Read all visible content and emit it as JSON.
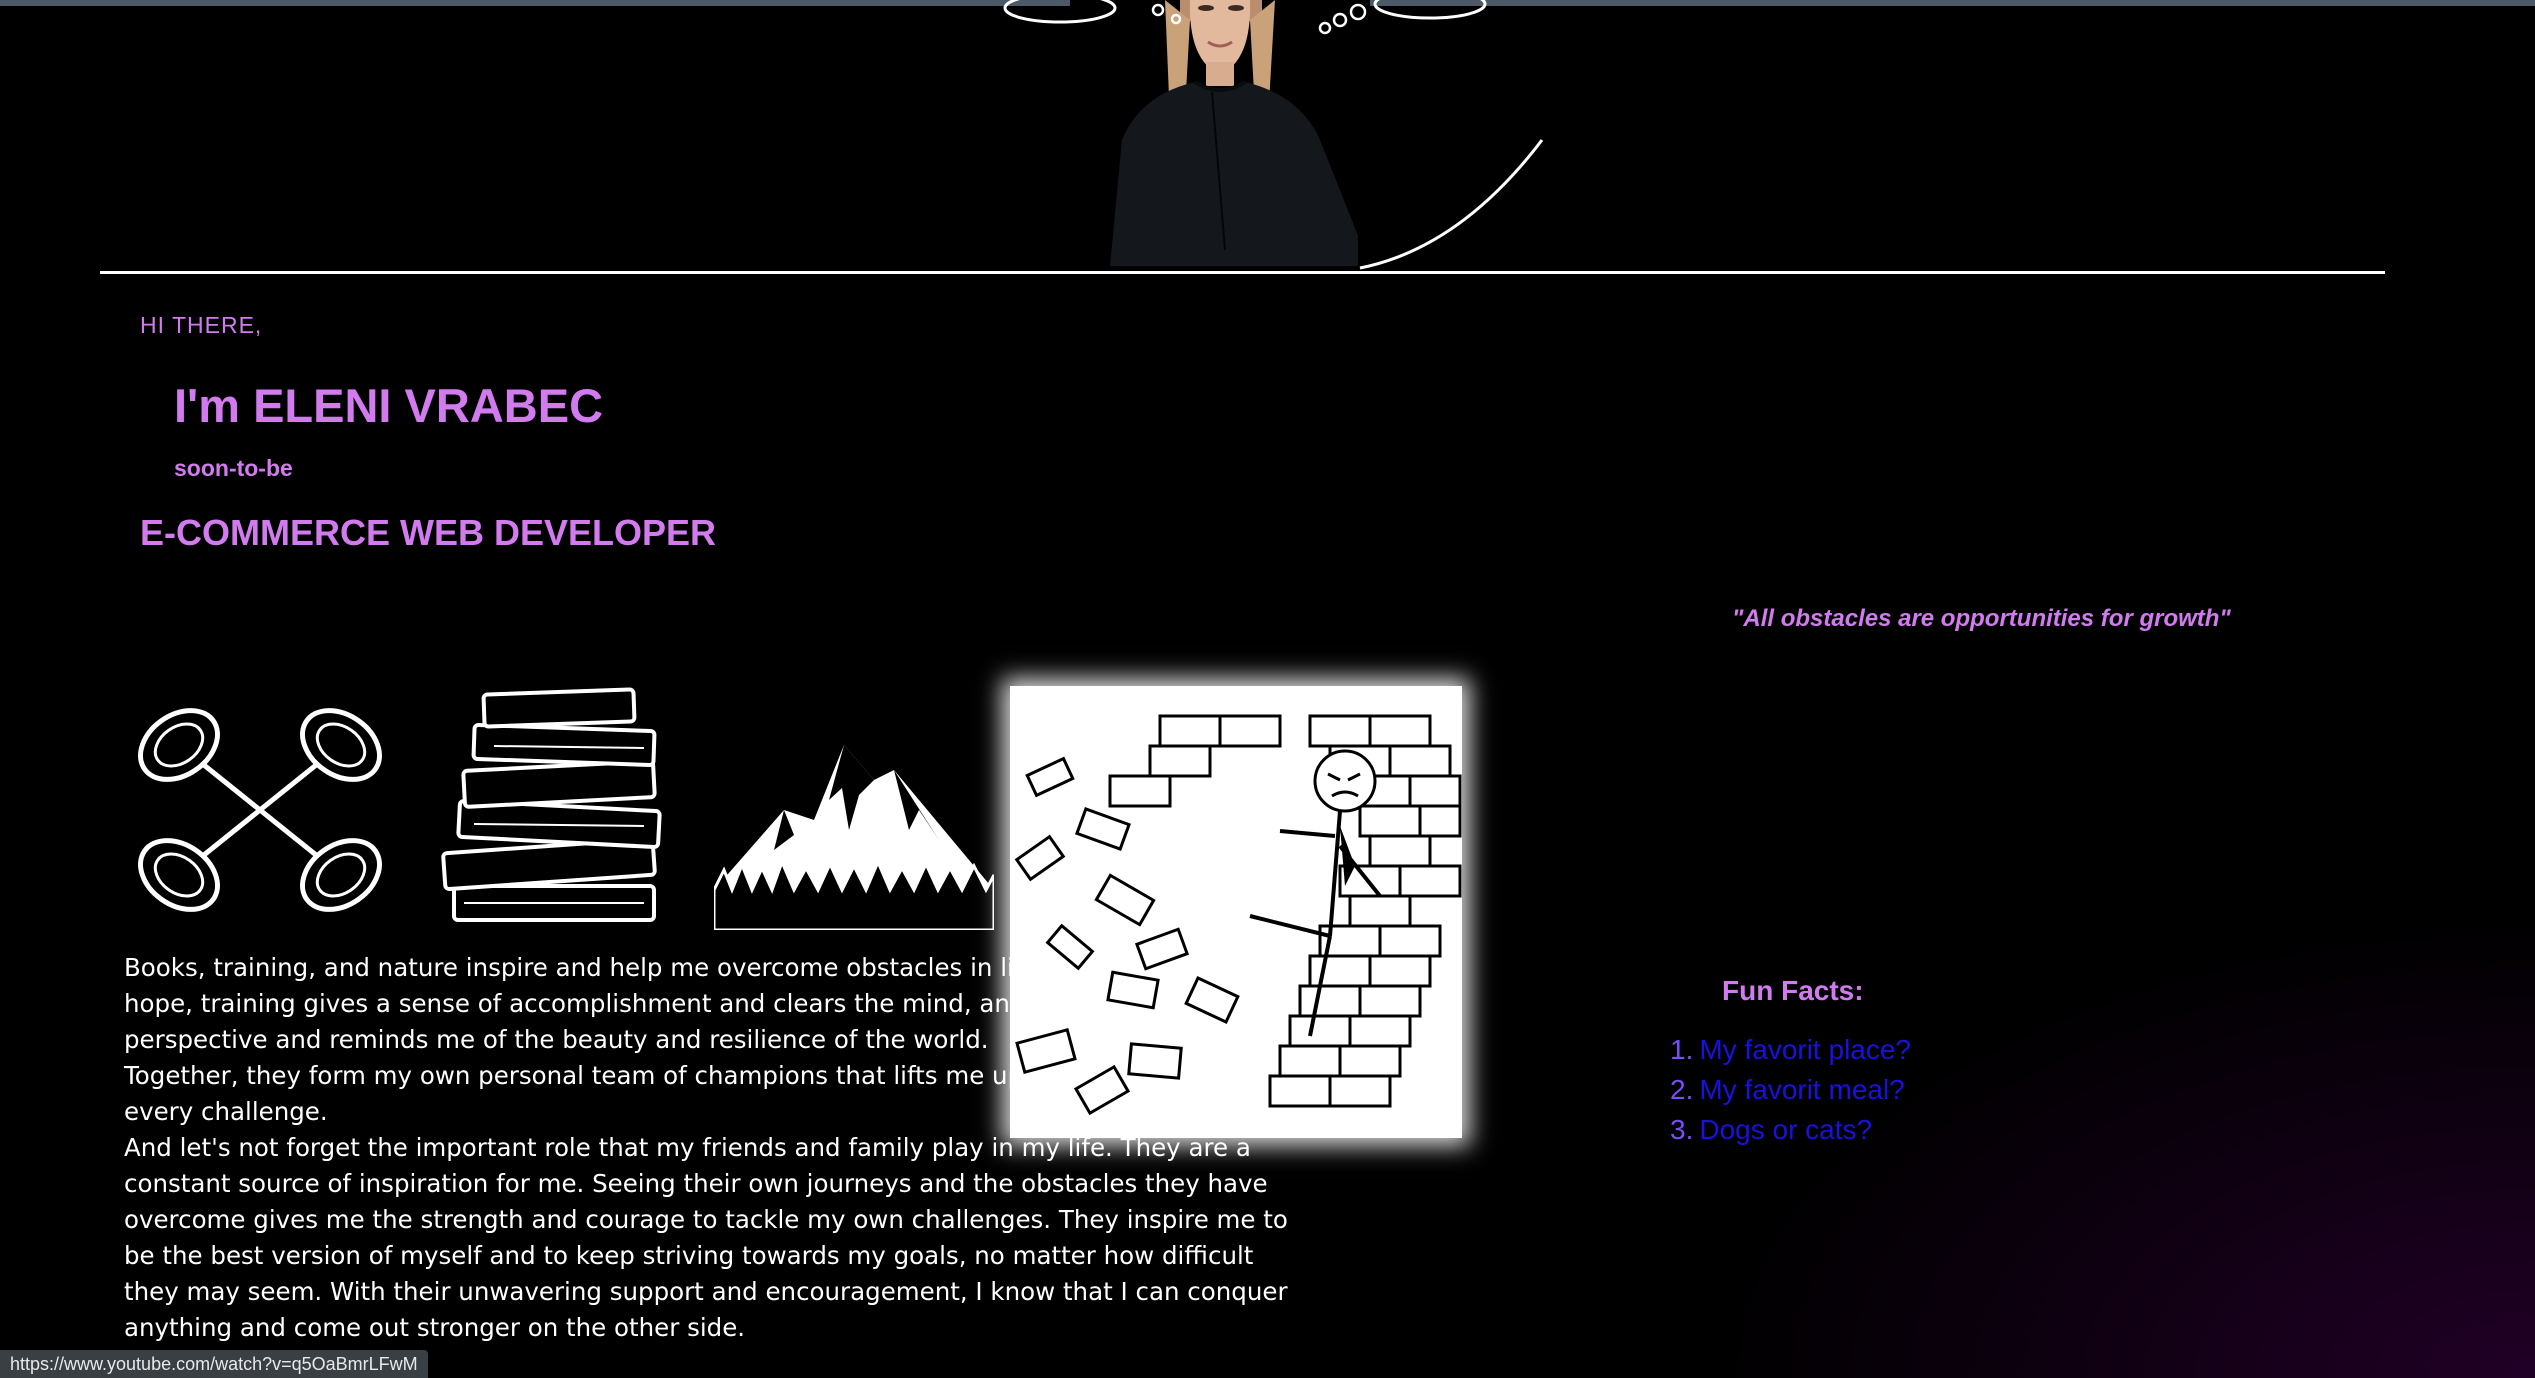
{
  "header": {
    "greeting": "HI THERE,",
    "name": "I'm ELENI VRABEC",
    "subtitle": "soon-to-be",
    "role": "E-COMMERCE WEB DEVELOPER"
  },
  "quote": "\"All obstacles are opportunities for growth\"",
  "icons": [
    "dumbbells-icon",
    "books-icon",
    "mountain-icon"
  ],
  "bio": {
    "paragraphs": [
      "Books, training, and nature inspire and help me overcome obstacles in life. Books give me hope, training gives a sense of accomplishment and clears the mind, and nature provides perspective and reminds me of the beauty and resilience of the world.",
      "Together, they form my own personal team of champions that lifts me up and helps me face every challenge.",
      "And let's not forget the important role that my friends and family play in my life. They are a constant source of inspiration for me. Seeing their own journeys and the obstacles they have overcome gives me the strength and courage to tackle my own challenges. They inspire me to be the best version of myself and to keep striving towards my goals, no matter how difficult they may seem. With their unwavering support and encouragement, I know that I can conquer anything and come out stronger on the other side."
    ]
  },
  "fun_facts": {
    "title": "Fun Facts:",
    "items": [
      {
        "num": "1.",
        "label": "My favorit place?"
      },
      {
        "num": "2.",
        "label": "My favorit meal?"
      },
      {
        "num": "3.",
        "label": "Dogs or cats?"
      }
    ]
  },
  "status_bar": {
    "url": "https://www.youtube.com/watch?v=q5OaBmrLFwM"
  },
  "colors": {
    "accent": "#d17bef",
    "link": "#1a10e0",
    "list_number": "#7a4dff",
    "background": "#000000"
  }
}
